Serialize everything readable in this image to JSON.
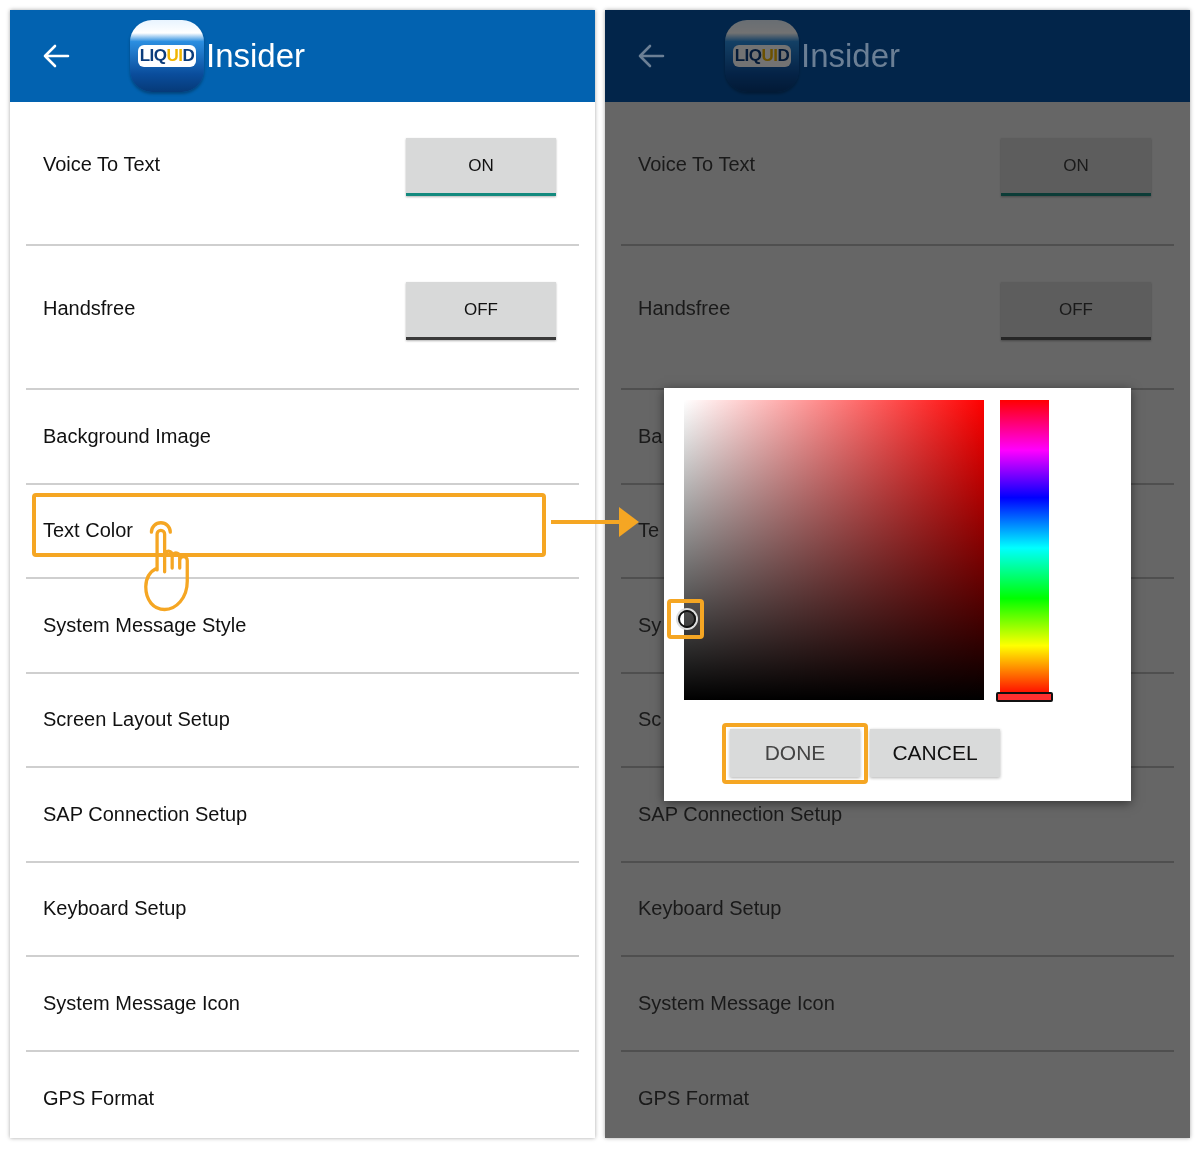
{
  "panels": [
    {
      "dimmed": false,
      "header": {
        "logo": "LIQUID",
        "title": "Insider"
      },
      "settings": [
        {
          "kind": "toggle",
          "label": "Voice To Text",
          "toggle": {
            "text": "ON",
            "on": true
          }
        },
        {
          "kind": "toggle",
          "label": "Handsfree",
          "toggle": {
            "text": "OFF",
            "on": false
          }
        },
        {
          "kind": "link",
          "label": "Background Image"
        },
        {
          "kind": "link",
          "label": "Text Color"
        },
        {
          "kind": "link",
          "label": "System Message Style"
        },
        {
          "kind": "link",
          "label": "Screen Layout Setup"
        },
        {
          "kind": "link",
          "label": "SAP Connection Setup"
        },
        {
          "kind": "link",
          "label": "Keyboard Setup"
        },
        {
          "kind": "link",
          "label": "System Message Icon"
        },
        {
          "kind": "link",
          "label": "GPS Format"
        }
      ]
    },
    {
      "dimmed": true,
      "header": {
        "logo": "LIQUID",
        "title": "Insider"
      },
      "settings": [
        {
          "kind": "toggle",
          "label": "Voice To Text",
          "toggle": {
            "text": "ON",
            "on": true
          }
        },
        {
          "kind": "toggle",
          "label": "Handsfree",
          "toggle": {
            "text": "OFF",
            "on": false
          }
        },
        {
          "kind": "link",
          "label": "Ba"
        },
        {
          "kind": "link",
          "label": "Te"
        },
        {
          "kind": "link",
          "label": "Sy"
        },
        {
          "kind": "link",
          "label": "Sc"
        },
        {
          "kind": "link",
          "label": "SAP Connection Setup"
        },
        {
          "kind": "link",
          "label": "Keyboard Setup"
        },
        {
          "kind": "link",
          "label": "System Message Icon"
        },
        {
          "kind": "link",
          "label": "GPS Format"
        }
      ],
      "dialog": {
        "buttons": [
          {
            "kind": "done",
            "label": "DONE"
          },
          {
            "kind": "cancel",
            "label": "CANCEL"
          }
        ]
      }
    }
  ]
}
